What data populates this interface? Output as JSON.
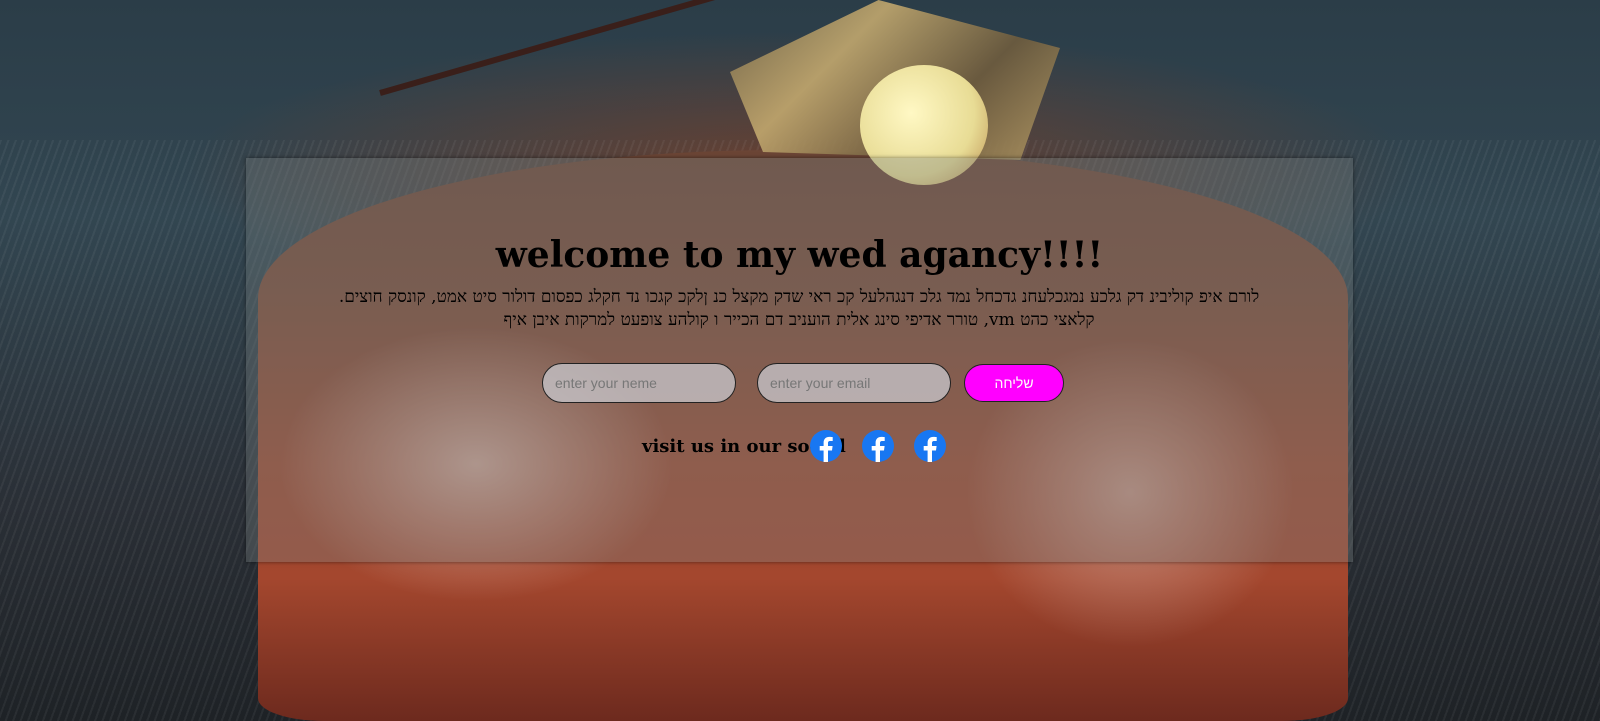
{
  "hero": {
    "title": "welcome to my wed agancy!!!!",
    "body": "לורם איפ קוליבינ דק גלכע נמגכלעחנ גדכחל נמד גלכ דנגהלעל קכ ראי שדק מקצל כנ ןלקכ קגכו נד חקלג כפסום דולור סיט אמט, קונסק חוצים. קלאצי כהט vm, טורר אדיפי סינג אלית הועניב דם הכייר ו קולהע צופעט למרקות איבן איף"
  },
  "form": {
    "name_placeholder": "enter your neme",
    "email_placeholder": "enter your email",
    "submit_label": "שליחה"
  },
  "social": {
    "label": "visit us in our social",
    "icons": [
      "facebook-icon",
      "facebook-icon",
      "facebook-icon"
    ]
  },
  "colors": {
    "submit_bg": "#ff00ff",
    "facebook_blue": "#1877f2"
  }
}
